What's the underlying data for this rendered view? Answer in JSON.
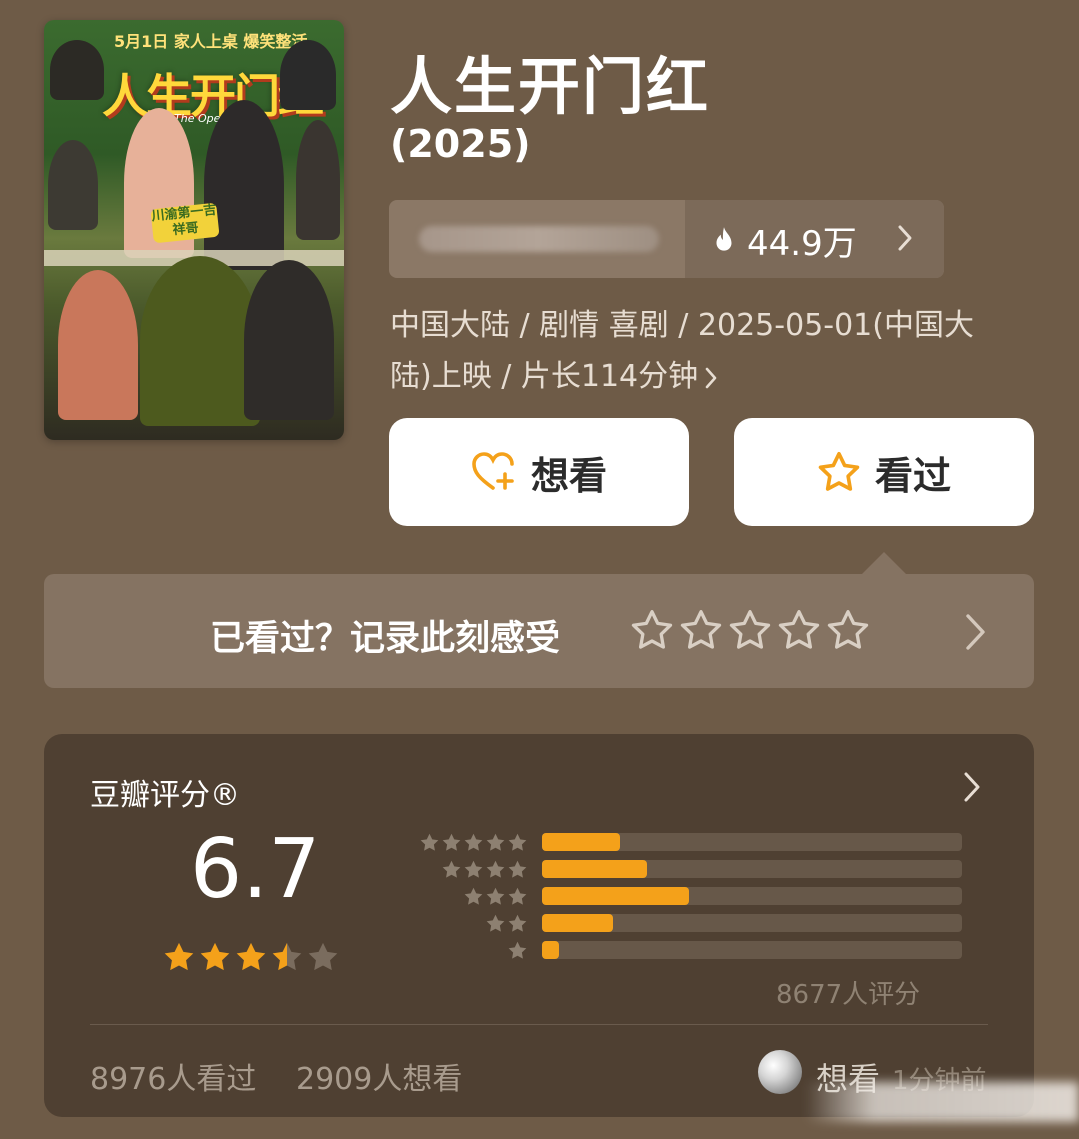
{
  "poster": {
    "top_line": "5月1日 家人上桌 爆笑整活",
    "title_art": "人生开门红",
    "subtitle_art": "The Open Door",
    "sign_text": "川渝第一吉祥哥"
  },
  "movie": {
    "title": "人生开门红",
    "year": "(2025)"
  },
  "heat": {
    "value": "44.9万",
    "icon": "flame-icon"
  },
  "meta": {
    "info": "中国大陆 / 剧情 喜剧 / 2025-05-01(中国大陆)上映 / 片长114分钟"
  },
  "actions": {
    "want_label": "想看",
    "seen_label": "看过",
    "accent": "#f4a11a"
  },
  "record": {
    "prompt": "已看过？记录此刻感受",
    "stars": 5
  },
  "rating": {
    "label": "豆瓣评分®",
    "score": "6.7",
    "stars": 3.5,
    "distribution": [
      {
        "stars": 5,
        "fraction": 0.185
      },
      {
        "stars": 4,
        "fraction": 0.25
      },
      {
        "stars": 3,
        "fraction": 0.35
      },
      {
        "stars": 2,
        "fraction": 0.17
      },
      {
        "stars": 1,
        "fraction": 0.04
      }
    ],
    "count": "8677人评分"
  },
  "stats": {
    "seen": "8976人看过",
    "want": "2909人想看"
  },
  "activity": {
    "action": "想看",
    "time": "1分钟前"
  },
  "colors": {
    "background": "#6e5b47",
    "card": "#4f4032",
    "bar_fill": "#f4a11a",
    "bar_track": "#675849"
  }
}
